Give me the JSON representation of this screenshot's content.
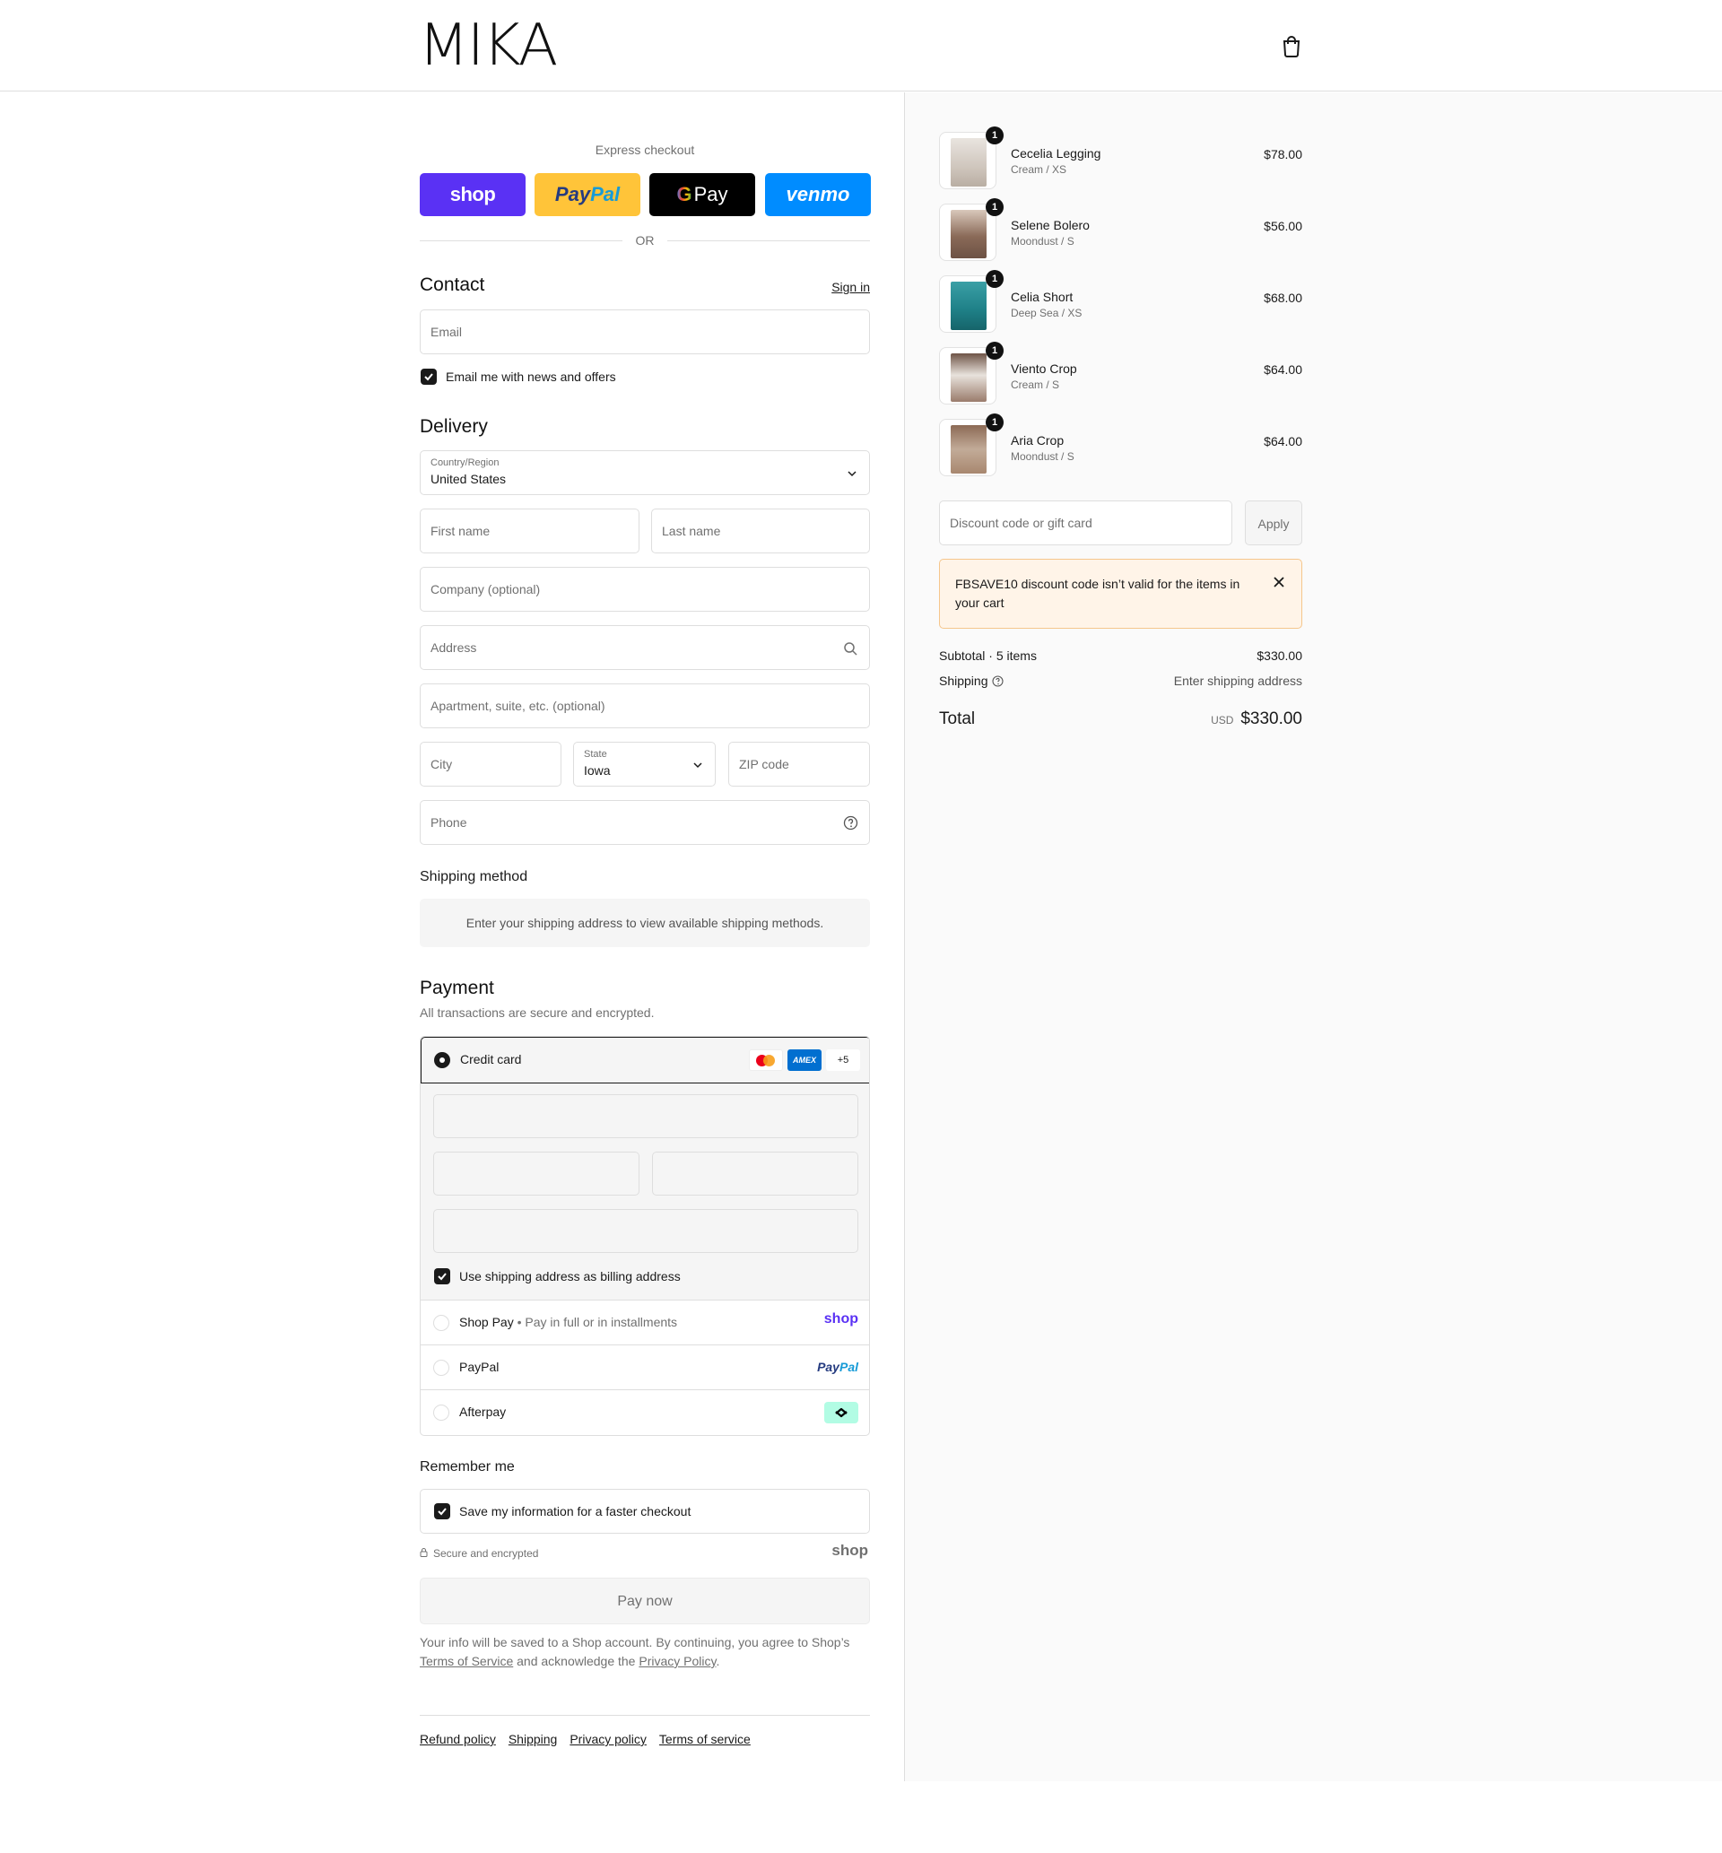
{
  "header": {
    "logo": "MIKA"
  },
  "express": {
    "title": "Express checkout",
    "shop": "shop",
    "paypal_a": "Pay",
    "paypal_b": "Pal",
    "gpay_g": "G",
    "gpay": "Pay",
    "venmo": "venmo",
    "or": "OR"
  },
  "contact": {
    "title": "Contact",
    "sign_in": "Sign in",
    "email_placeholder": "Email",
    "newsletter": "Email me with news and offers"
  },
  "delivery": {
    "title": "Delivery",
    "country_label": "Country/Region",
    "country_value": "United States",
    "first_name": "First name",
    "last_name": "Last name",
    "company": "Company (optional)",
    "address": "Address",
    "apartment": "Apartment, suite, etc. (optional)",
    "city": "City",
    "state_label": "State",
    "state_value": "Iowa",
    "zip": "ZIP code",
    "phone": "Phone"
  },
  "shipping_method": {
    "title": "Shipping method",
    "info": "Enter your shipping address to view available shipping methods."
  },
  "payment": {
    "title": "Payment",
    "subtitle": "All transactions are secure and encrypted.",
    "credit_card": "Credit card",
    "amex": "AMEX",
    "more_cards": "+5",
    "billing_same": "Use shipping address as billing address",
    "shop_pay": "Shop Pay",
    "shop_pay_sub": "Pay in full or in installments",
    "shop_logo": "shop",
    "paypal": "PayPal",
    "paypal_logo_a": "Pay",
    "paypal_logo_b": "Pal",
    "afterpay": "Afterpay"
  },
  "remember": {
    "title": "Remember me",
    "save_info": "Save my information for a faster checkout",
    "secure": "Secure and encrypted",
    "shop_logo": "shop"
  },
  "pay_now": "Pay now",
  "legal": {
    "text1": "Your info will be saved to a Shop account. By continuing, you agree to Shop’s ",
    "terms": "Terms of Service",
    "text2": " and acknowledge the ",
    "privacy": "Privacy Policy",
    "text3": "."
  },
  "footer": {
    "links": [
      "Refund policy",
      "Shipping",
      "Privacy policy",
      "Terms of service"
    ]
  },
  "cart": {
    "items": [
      {
        "name": "Cecelia Legging",
        "variant": "Cream / XS",
        "price": "$78.00",
        "qty": "1",
        "color": "#cfc6bd"
      },
      {
        "name": "Selene Bolero",
        "variant": "Moondust / S",
        "price": "$56.00",
        "qty": "1",
        "color": "#8a6a58"
      },
      {
        "name": "Celia Short",
        "variant": "Deep Sea / XS",
        "price": "$68.00",
        "qty": "1",
        "color": "#1e7f86"
      },
      {
        "name": "Viento Crop",
        "variant": "Cream / S",
        "price": "$64.00",
        "qty": "1",
        "color": "#9a7c6c"
      },
      {
        "name": "Aria Crop",
        "variant": "Moondust / S",
        "price": "$64.00",
        "qty": "1",
        "color": "#a8876f"
      }
    ],
    "discount_placeholder": "Discount code or gift card",
    "apply": "Apply",
    "error": "FBSAVE10 discount code isn’t valid for the items in your cart",
    "subtotal_label": "Subtotal · 5 items",
    "subtotal_value": "$330.00",
    "shipping_label": "Shipping",
    "shipping_value": "Enter shipping address",
    "total_label": "Total",
    "currency": "USD",
    "total_value": "$330.00"
  }
}
